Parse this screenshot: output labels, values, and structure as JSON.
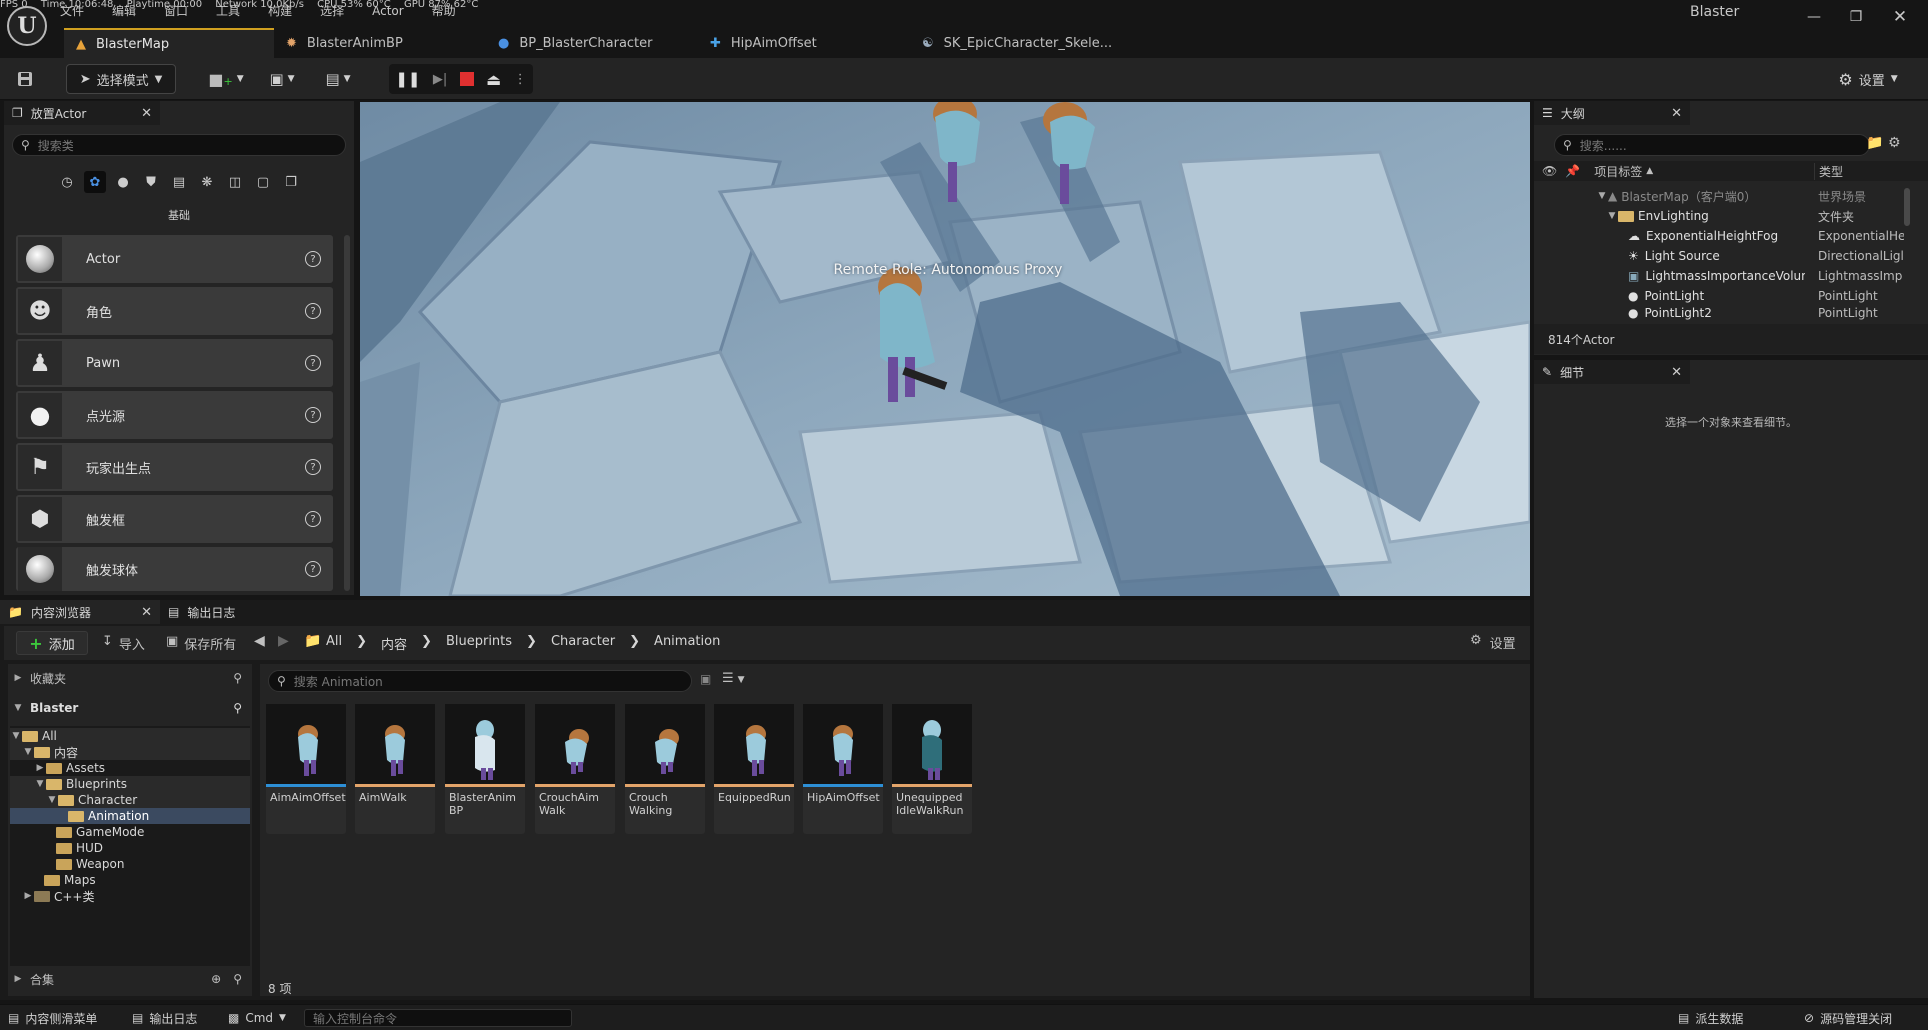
{
  "stats": {
    "fps": "FPS 0",
    "time": "Time 10:06:48",
    "playtime": "Playtime 00:00",
    "network": "Network 10.0Kb/s",
    "cpu": "CPU 53% 60°C",
    "gpu": "GPU 87% 62°C"
  },
  "menu": [
    "文件",
    "编辑",
    "窗口",
    "工具",
    "构建",
    "选择",
    "Actor",
    "帮助"
  ],
  "window_title": "Blaster",
  "tabs": [
    {
      "label": "BlasterMap",
      "icon": "level-icon"
    },
    {
      "label": "BlasterAnimBP",
      "icon": "anim-blueprint-icon"
    },
    {
      "label": "BP_BlasterCharacter",
      "icon": "character-blueprint-icon"
    },
    {
      "label": "HipAimOffset",
      "icon": "aim-offset-icon"
    },
    {
      "label": "SK_EpicCharacter_Skele...",
      "icon": "skeleton-icon"
    }
  ],
  "toolbar": {
    "mode_label": "选择模式",
    "settings_label": "设置"
  },
  "place_actors": {
    "tab_label": "放置Actor",
    "search_placeholder": "搜索类",
    "category_label": "基础",
    "items": [
      "Actor",
      "角色",
      "Pawn",
      "点光源",
      "玩家出生点",
      "触发框",
      "触发球体"
    ]
  },
  "viewport": {
    "overlay_text": "Remote Role: Autonomous Proxy"
  },
  "outliner": {
    "tab_label": "大纲",
    "search_placeholder": "搜索......",
    "col_label": "项目标签",
    "col_type": "类型",
    "rows": [
      {
        "label": "BlasterMap（客户端0）",
        "type": "世界场景"
      },
      {
        "label": "EnvLighting",
        "type": "文件夹"
      },
      {
        "label": "ExponentialHeightFog",
        "type": "ExponentialHe"
      },
      {
        "label": "Light Source",
        "type": "DirectionalLigl"
      },
      {
        "label": "LightmassImportanceVolum",
        "type": "LightmassImp"
      },
      {
        "label": "PointLight",
        "type": "PointLight"
      },
      {
        "label": "PointLight2",
        "type": "PointLight"
      }
    ],
    "count": "814个Actor"
  },
  "details": {
    "tab_label": "细节",
    "empty_text": "选择一个对象来查看细节。"
  },
  "content_browser": {
    "tab_label": "内容浏览器",
    "log_tab_label": "输出日志",
    "add_label": "添加",
    "import_label": "导入",
    "save_all_label": "保存所有",
    "breadcrumb": [
      "All",
      "内容",
      "Blueprints",
      "Character",
      "Animation"
    ],
    "settings_label": "设置",
    "favorites_label": "收藏夹",
    "project_label": "Blaster",
    "search_placeholder": "搜索 Animation",
    "tree": [
      "All",
      "内容",
      "Assets",
      "Blueprints",
      "Character",
      "Animation",
      "GameMode",
      "HUD",
      "Weapon",
      "Maps",
      "C++类"
    ],
    "collections_label": "合集",
    "assets": [
      {
        "name": "AimAimOffset",
        "bar": "#2d8fd6"
      },
      {
        "name": "AimWalk",
        "bar": "#e3a46a"
      },
      {
        "name": "BlasterAnim BP",
        "bar": "#e3a46a"
      },
      {
        "name": "CrouchAim Walk",
        "bar": "#e3a46a"
      },
      {
        "name": "Crouch Walking",
        "bar": "#e3a46a"
      },
      {
        "name": "EquippedRun",
        "bar": "#e3a46a"
      },
      {
        "name": "HipAimOffset",
        "bar": "#2d8fd6"
      },
      {
        "name": "Unequipped IdleWalkRun",
        "bar": "#e3a46a"
      }
    ],
    "count": "8 项"
  },
  "statusbar": {
    "drawer": "内容侧滑菜单",
    "log": "输出日志",
    "cmd": "Cmd",
    "console_placeholder": "输入控制台命令",
    "derived": "派生数据",
    "source_control": "源码管理关闭"
  }
}
